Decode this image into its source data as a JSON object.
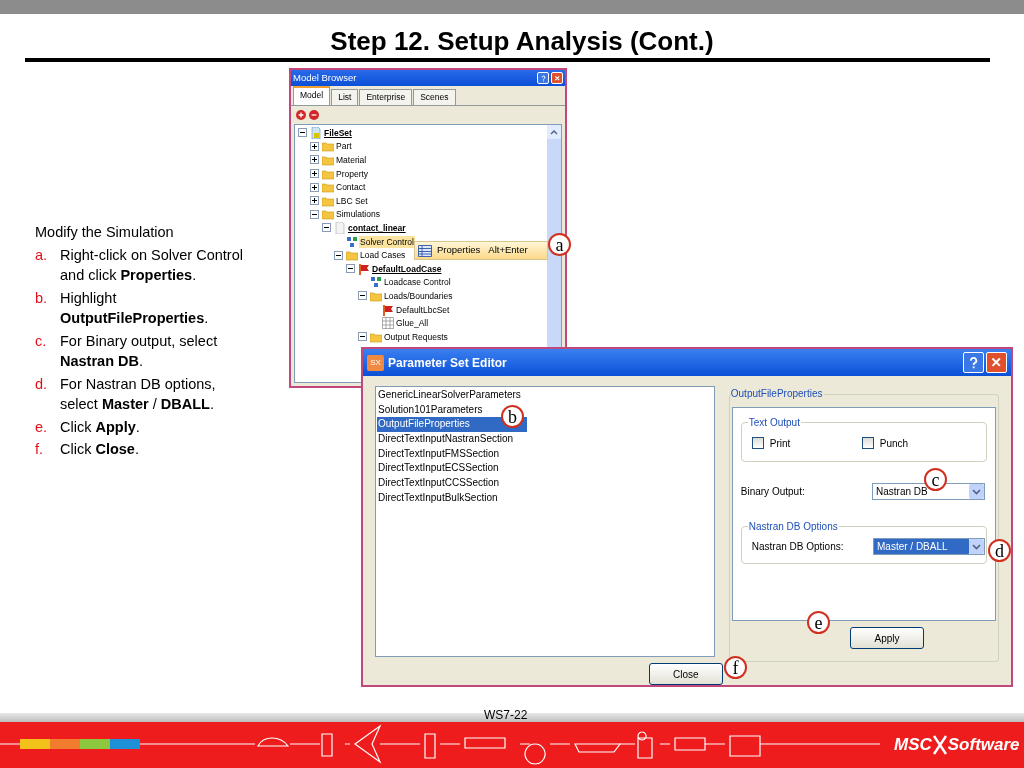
{
  "title": "Step 12. Setup Analysis (Cont.)",
  "instructions": {
    "heading": "Modify the Simulation",
    "steps": [
      {
        "marker": "a.",
        "text": "Right-click on Solver Control and click **Properties**."
      },
      {
        "marker": "b.",
        "text": "Highlight **OutputFileProperties**."
      },
      {
        "marker": "c.",
        "text": "For Binary output, select **Nastran DB**."
      },
      {
        "marker": "d.",
        "text": "For Nastran DB options, select **Master** / **DBALL**."
      },
      {
        "marker": "e.",
        "text": "Click **Apply**."
      },
      {
        "marker": "f.",
        "text": "Click **Close**."
      }
    ]
  },
  "model_browser": {
    "title": "Model Browser",
    "tabs": [
      {
        "label": "Model",
        "selected": true
      },
      {
        "label": "List",
        "selected": false
      },
      {
        "label": "Enterprise",
        "selected": false
      },
      {
        "label": "Scenes",
        "selected": false
      }
    ],
    "tree": [
      {
        "label": "FileSet",
        "kind": "fileset",
        "bold": true,
        "selected": false,
        "expanded": true,
        "children": [
          {
            "label": "Part",
            "kind": "folder",
            "bold": false,
            "selected": false,
            "expanded": false
          },
          {
            "label": "Material",
            "kind": "folder",
            "bold": false,
            "selected": false,
            "expanded": false
          },
          {
            "label": "Property",
            "kind": "folder",
            "bold": false,
            "selected": false,
            "expanded": false
          },
          {
            "label": "Contact",
            "kind": "folder",
            "bold": false,
            "selected": false,
            "expanded": false
          },
          {
            "label": "LBC Set",
            "kind": "folder",
            "bold": false,
            "selected": false,
            "expanded": false
          },
          {
            "label": "Simulations",
            "kind": "folder",
            "bold": false,
            "selected": false,
            "expanded": true,
            "children": [
              {
                "label": "contact_linear",
                "kind": "document",
                "bold": true,
                "selected": false,
                "expanded": true,
                "children": [
                  {
                    "label": "Solver Control",
                    "kind": "control",
                    "bold": false,
                    "selected": true
                  },
                  {
                    "label": "Load Cases",
                    "kind": "folder",
                    "bold": false,
                    "selected": false,
                    "expanded": true,
                    "children": [
                      {
                        "label": "DefaultLoadCase",
                        "kind": "loadcase",
                        "bold": true,
                        "selected": false,
                        "expanded": true,
                        "children": [
                          {
                            "label": "Loadcase Control",
                            "kind": "control",
                            "bold": false,
                            "selected": false
                          },
                          {
                            "label": "Loads/Boundaries",
                            "kind": "folder",
                            "bold": false,
                            "selected": false,
                            "expanded": true,
                            "children": [
                              {
                                "label": "DefaultLbcSet",
                                "kind": "loadcase",
                                "bold": false,
                                "selected": false
                              },
                              {
                                "label": "Glue_All",
                                "kind": "grid",
                                "bold": false,
                                "selected": false
                              }
                            ]
                          },
                          {
                            "label": "Output Requests",
                            "kind": "folder",
                            "bold": false,
                            "selected": false,
                            "expanded": true
                          }
                        ]
                      }
                    ]
                  }
                ]
              }
            ]
          }
        ]
      }
    ],
    "context_menu": {
      "label": "Properties",
      "shortcut": "Alt+Enter"
    }
  },
  "parameter_editor": {
    "title": "Parameter Set Editor",
    "app_badge": "SX",
    "parameter_sets": [
      {
        "label": "GenericLinearSolverParameters",
        "selected": false
      },
      {
        "label": "Solution101Parameters",
        "selected": false
      },
      {
        "label": "OutputFileProperties",
        "selected": true
      },
      {
        "label": "DirectTextInputNastranSection",
        "selected": false
      },
      {
        "label": "DirectTextInputFMSSection",
        "selected": false
      },
      {
        "label": "DirectTextInputECSSection",
        "selected": false
      },
      {
        "label": "DirectTextInputCCSSection",
        "selected": false
      },
      {
        "label": "DirectTextInputBulkSection",
        "selected": false
      }
    ],
    "group_title": "OutputFileProperties",
    "text_output": {
      "title": "Text Output",
      "options": [
        {
          "label": "Print",
          "checked": false
        },
        {
          "label": "Punch",
          "checked": false
        }
      ]
    },
    "binary_output": {
      "label": "Binary Output:",
      "value": "Nastran DB"
    },
    "nastran_db": {
      "title": "Nastran DB Options",
      "label": "Nastran DB Options:",
      "value": "Master / DBALL"
    },
    "apply": "Apply",
    "close": "Close"
  },
  "callouts": [
    "a",
    "b",
    "c",
    "d",
    "e",
    "f"
  ],
  "footer": {
    "page": "WS7-22",
    "logo_left": "MSC",
    "logo_right": "Software"
  }
}
